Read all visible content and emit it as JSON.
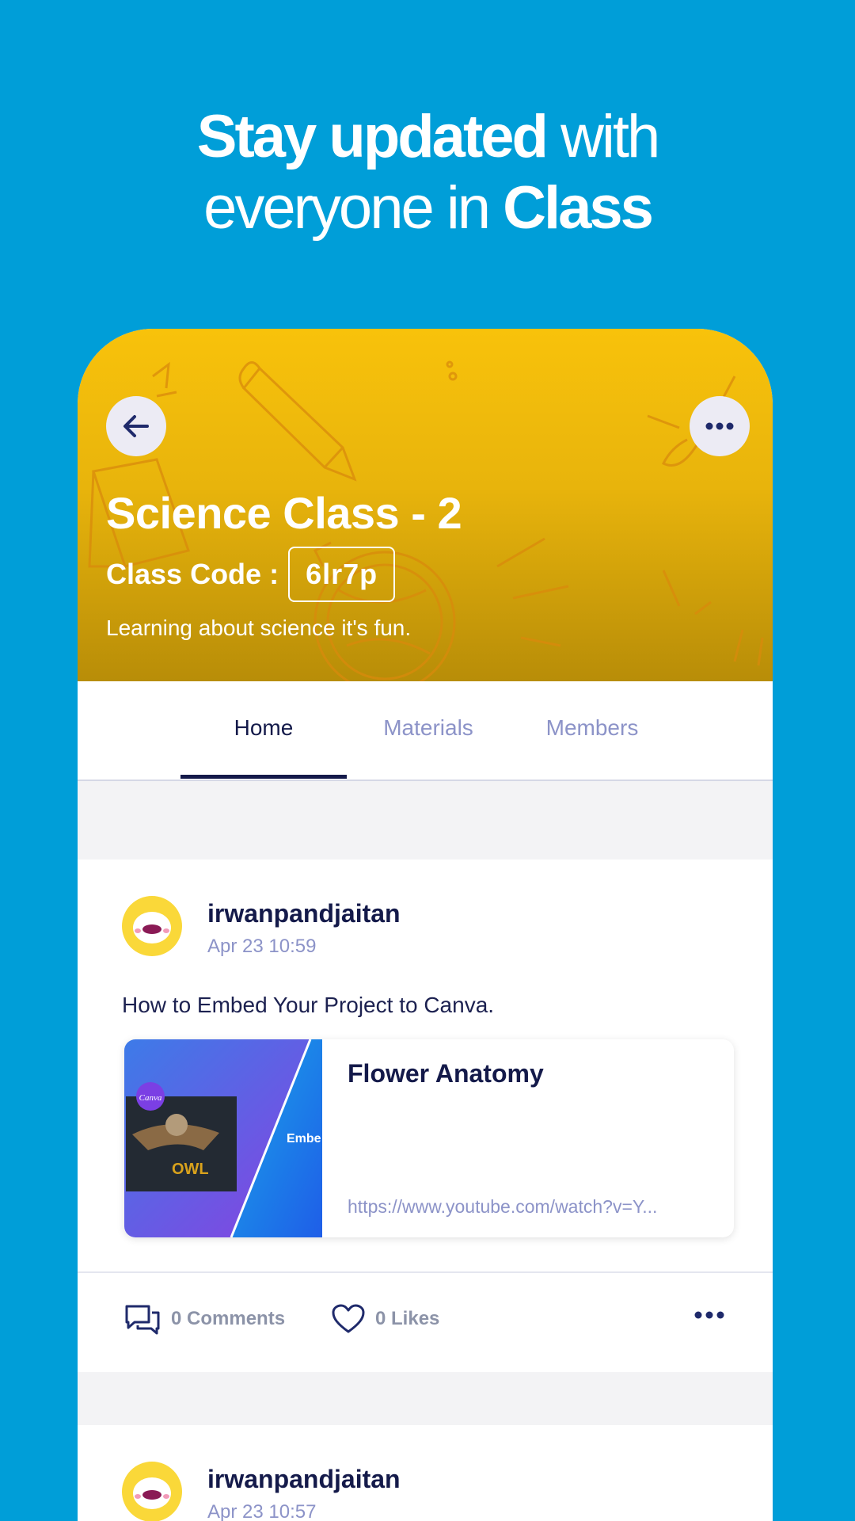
{
  "headline": {
    "line1_bold": "Stay updated",
    "line1_light": " with",
    "line2_light": "everyone in ",
    "line2_bold": "Class"
  },
  "class_header": {
    "title": "Science Class - 2",
    "code_label": "Class Code :",
    "code_value": "6lr7p",
    "description": "Learning about science it's fun."
  },
  "tabs": [
    {
      "label": "Home",
      "active": true
    },
    {
      "label": "Materials",
      "active": false
    },
    {
      "label": "Members",
      "active": false
    }
  ],
  "posts": [
    {
      "author": "irwanpandjaitan",
      "date": "Apr 23 10:59",
      "text": "How to Embed Your Project to Canva.",
      "link": {
        "title": "Flower Anatomy",
        "url": "https://www.youtube.com/watch?v=Y...",
        "thumb_brand": "Canva",
        "thumb_caption": "Embe",
        "thumb_word": "OWL"
      },
      "comments_label": "0 Comments",
      "likes_label": "0 Likes"
    },
    {
      "author": "irwanpandjaitan",
      "date": "Apr 23 10:57"
    }
  ],
  "colors": {
    "background": "#009ed8",
    "banner_top": "#f8c20b",
    "banner_bottom": "#b88d08",
    "text_dark": "#141a4a",
    "text_muted": "#8c93c8",
    "avatar": "#fad839"
  }
}
